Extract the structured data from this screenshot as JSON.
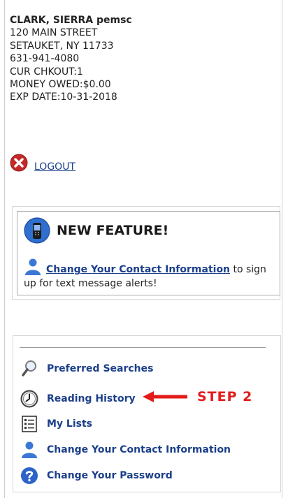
{
  "patron": {
    "name": "CLARK, SIERRA pemsc",
    "address_line1": "120 MAIN STREET",
    "address_line2": "SETAUKET, NY 11733",
    "phone": "631-941-4080",
    "checkouts": "CUR CHKOUT:1",
    "money_owed": "MONEY OWED:$0.00",
    "exp_date": "EXP DATE:10-31-2018"
  },
  "logout": {
    "label": "LOGOUT",
    "icon": "x-circle-icon",
    "color": "#c62828"
  },
  "feature": {
    "title": "NEW FEATURE!",
    "link_label": "Change Your Contact Information",
    "suffix_text": " to sign up for text message alerts!"
  },
  "links": [
    {
      "label": "Preferred Searches",
      "icon": "magnifier-icon"
    },
    {
      "label": "Reading History",
      "icon": "clock-icon"
    },
    {
      "label": "My Lists",
      "icon": "list-icon"
    },
    {
      "label": "Change Your Contact Information",
      "icon": "person-icon"
    },
    {
      "label": "Change Your Password",
      "icon": "question-icon"
    }
  ],
  "annotation": {
    "label": "STEP 2",
    "color": "#e31b1b"
  },
  "colors": {
    "link": "#1b3f8a",
    "person_blue": "#3b78d6"
  }
}
